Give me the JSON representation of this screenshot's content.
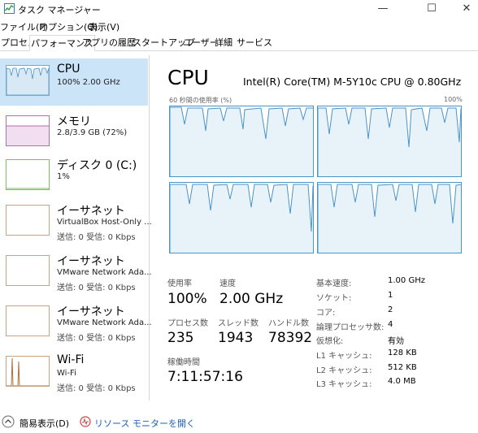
{
  "window": {
    "title": "タスク マネージャー",
    "minimize": "—",
    "maximize": "☐",
    "close": "✕"
  },
  "menu": [
    "ファイル(F)",
    "オプション(O)",
    "表示(V)"
  ],
  "tabs": [
    "プロセス",
    "パフォーマンス",
    "アプリの履歴",
    "スタートアップ",
    "ユーザー",
    "詳細",
    "サービス"
  ],
  "active_tab": "パフォーマンス",
  "sidebar": {
    "items": [
      {
        "title": "CPU",
        "sub1": "100% 2.00 GHz",
        "sub2": "",
        "border_color": "#7aa6c8"
      },
      {
        "title": "メモリ",
        "sub1": "2.8/3.9 GB (72%)",
        "sub2": "",
        "border_color": "#b36cb3"
      },
      {
        "title": "ディスク 0 (C:)",
        "sub1": "1%",
        "sub2": "",
        "border_color": "#7cbf5e"
      },
      {
        "title": "イーサネット",
        "sub1": "VirtualBox Host-Only ...",
        "sub2": "送信: 0  受信: 0 Kbps",
        "border_color": "#c9a37e"
      },
      {
        "title": "イーサネット",
        "sub1": "VMware Network Ada...",
        "sub2": "送信: 0  受信: 0 Kbps",
        "border_color": "#c9a37e"
      },
      {
        "title": "イーサネット",
        "sub1": "VMware Network Ada...",
        "sub2": "送信: 0  受信: 0 Kbps",
        "border_color": "#c9a37e"
      },
      {
        "title": "Wi-Fi",
        "sub1": "Wi-Fi",
        "sub2": "送信: 0  受信: 0 Kbps",
        "border_color": "#c9a37e"
      }
    ]
  },
  "main": {
    "heading": "CPU",
    "model": "Intel(R) Core(TM) M-5Y10c CPU @ 0.80GHz",
    "graph_caption": "60 秒間の使用率 (%)",
    "graph_max": "100%",
    "stats": {
      "usage_label": "使用率",
      "usage_value": "100%",
      "speed_label": "速度",
      "speed_value": "2.00 GHz",
      "processes_label": "プロセス数",
      "processes_value": "235",
      "threads_label": "スレッド数",
      "threads_value": "1943",
      "handles_label": "ハンドル数",
      "handles_value": "78392",
      "uptime_label": "稼働時間",
      "uptime_value": "7:11:57:16"
    },
    "specs": [
      {
        "label": "基本速度:",
        "value": "1.00 GHz"
      },
      {
        "label": "ソケット:",
        "value": "1"
      },
      {
        "label": "コア:",
        "value": "2"
      },
      {
        "label": "論理プロセッサ数:",
        "value": "4"
      },
      {
        "label": "仮想化:",
        "value": "有効"
      },
      {
        "label": "L1 キャッシュ:",
        "value": "128 KB"
      },
      {
        "label": "L2 キャッシュ:",
        "value": "512 KB"
      },
      {
        "label": "L3 キャッシュ:",
        "value": "4.0 MB"
      }
    ]
  },
  "footer": {
    "compact_label": "簡易表示(D)",
    "resource_monitor_label": "リソース モニターを開く",
    "link_color": "#1a5fb4"
  },
  "colors": {
    "accent": "#4a94c8",
    "selection": "#cce4f7",
    "graph_fill": "#e8f2f9"
  }
}
